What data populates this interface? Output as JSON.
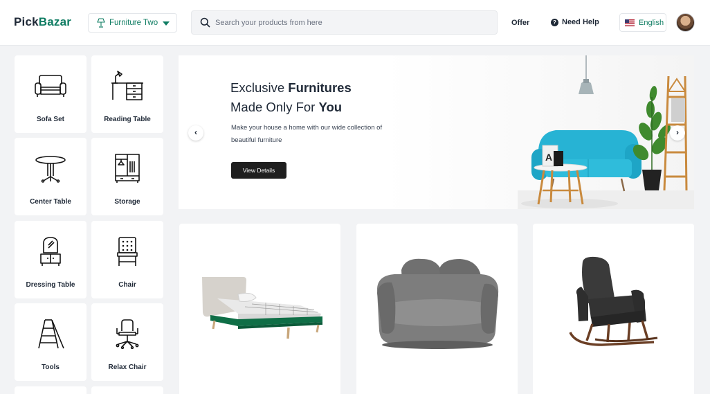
{
  "header": {
    "logo_part1": "Pick",
    "logo_part2": "Bazar",
    "category_select": "Furniture Two",
    "search_placeholder": "Search your products from here",
    "nav_offer": "Offer",
    "nav_help": "Need Help",
    "language": "English"
  },
  "categories": [
    {
      "label": "Sofa Set",
      "icon": "sofa-icon"
    },
    {
      "label": "Reading Table",
      "icon": "reading-table-icon"
    },
    {
      "label": "Center Table",
      "icon": "center-table-icon"
    },
    {
      "label": "Storage",
      "icon": "wardrobe-icon"
    },
    {
      "label": "Dressing Table",
      "icon": "dressing-table-icon"
    },
    {
      "label": "Chair",
      "icon": "chair-icon"
    },
    {
      "label": "Tools",
      "icon": "ladder-icon"
    },
    {
      "label": "Relax Chair",
      "icon": "office-chair-icon"
    }
  ],
  "hero": {
    "title_line1_normal": "Exclusive ",
    "title_line1_bold": "Furnitures",
    "title_line2_normal": "Made Only For ",
    "title_line2_bold": "You",
    "subtitle": "Make your house a home with our wide collection of beautiful furniture",
    "button": "View Details",
    "prev_arrow": "‹",
    "next_arrow": "›"
  },
  "colors": {
    "accent": "#0e7c62",
    "page_bg": "#f2f3f5",
    "sofa_blue": "#27b3d4",
    "bed_green": "#0f6e46"
  }
}
